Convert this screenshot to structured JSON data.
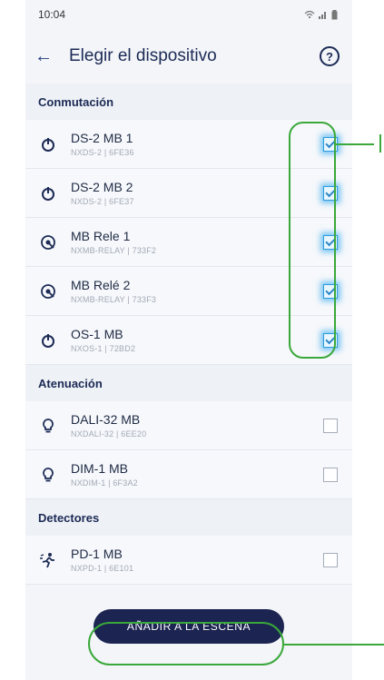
{
  "status": {
    "time": "10:04"
  },
  "header": {
    "title": "Elegir el dispositivo",
    "back_icon": "back-arrow-icon",
    "help_icon": "help-icon"
  },
  "sections": [
    {
      "label": "Conmutación"
    },
    {
      "label": "Atenuación"
    },
    {
      "label": "Detectores"
    }
  ],
  "devices": [
    {
      "name": "DS-2 MB 1",
      "sub": "NXDS-2 | 6FE36",
      "icon": "power-icon",
      "checked": true
    },
    {
      "name": "DS-2 MB 2",
      "sub": "NXDS-2 | 6FE37",
      "icon": "power-icon",
      "checked": true
    },
    {
      "name": "MB Rele 1",
      "sub": "NXMB-RELAY | 733F2",
      "icon": "relay-icon",
      "checked": true
    },
    {
      "name": "MB Relé 2",
      "sub": "NXMB-RELAY | 733F3",
      "icon": "relay-icon",
      "checked": true
    },
    {
      "name": "OS-1 MB",
      "sub": "NXOS-1 | 72BD2",
      "icon": "power-icon",
      "checked": true
    },
    {
      "name": "DALI-32 MB",
      "sub": "NXDALI-32 | 6EE20",
      "icon": "bulb-icon",
      "checked": false
    },
    {
      "name": "DIM-1 MB",
      "sub": "NXDIM-1 | 6F3A2",
      "icon": "bulb-icon",
      "checked": false
    },
    {
      "name": "PD-1 MB",
      "sub": "NXPD-1 | 6E101",
      "icon": "motion-icon",
      "checked": false
    }
  ],
  "cta": {
    "label": "AÑADIR A LA ESCENA"
  },
  "colors": {
    "accent": "#1c2452",
    "check": "#2b9bdb",
    "annotation": "#3aa83a"
  }
}
